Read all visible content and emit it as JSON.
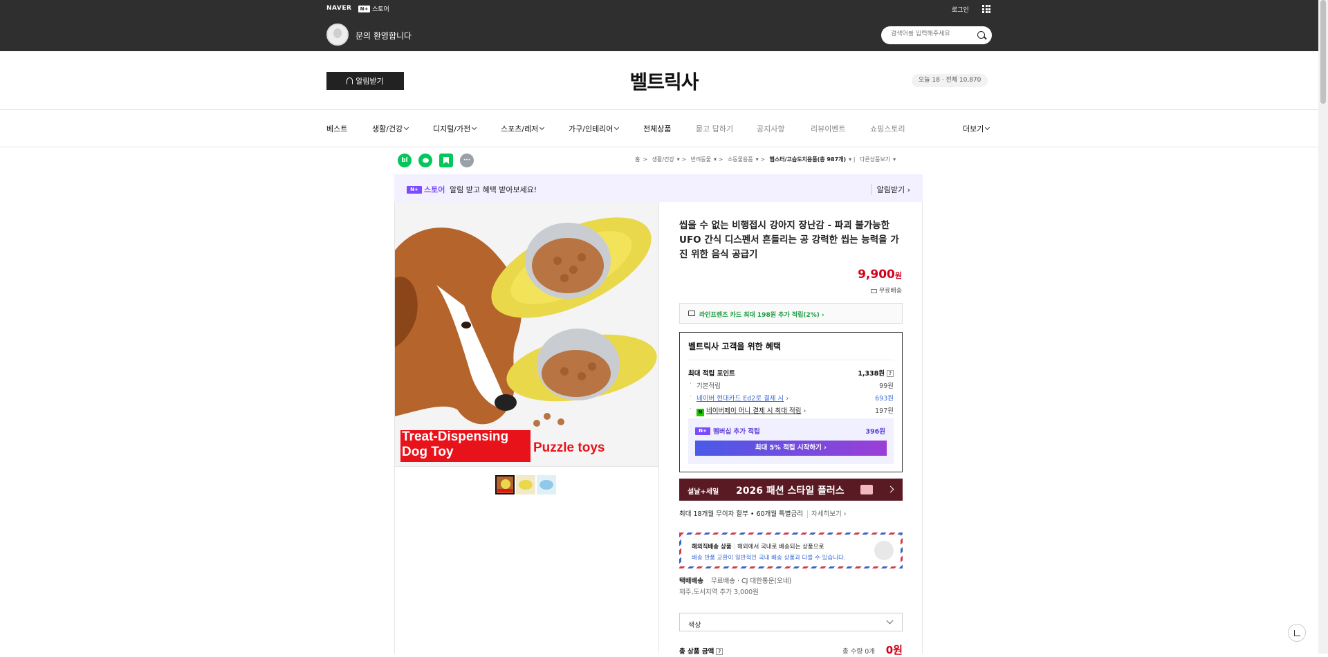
{
  "topbar": {
    "brand": "NAVER",
    "store_badge": "N+",
    "store_label": "스토어",
    "login": "로그인",
    "greeting": "문의 환영합니다",
    "search_placeholder": "검색어를 입력해주세요"
  },
  "header": {
    "alarm_button": "알림받기",
    "store_name": "벨트릭사",
    "visits": "오늘 18 · 전체 10,870"
  },
  "nav": {
    "items": [
      "베스트",
      "생활/건강",
      "디지털/가전",
      "스포츠/레저",
      "가구/인테리어",
      "전체상품",
      "묻고 답하기",
      "공지사항",
      "리뷰이벤트",
      "쇼핑스토리"
    ],
    "more": "더보기"
  },
  "share_buttons": [
    {
      "label": "bl",
      "color": "#03c75a"
    },
    {
      "label": "",
      "color": "#03c75a"
    },
    {
      "label": "",
      "color": "#03c75a"
    },
    {
      "label": "···",
      "color": "#9aa0a6"
    }
  ],
  "breadcrumb": {
    "items": [
      "홈",
      "생활/건강",
      "반려동물",
      "소동물용품",
      "햄스터/고슴도치용품(총 987개)",
      "다른상품보기"
    ]
  },
  "notice": {
    "badge": "N+",
    "brand": "스토어",
    "message": "알림 받고 혜택 받아보세요!",
    "action": "알림받기"
  },
  "product": {
    "title": "씹을 수 없는 비행접시 강아지 장난감 - 파괴 불가능한 UFO 간식 디스펜서 흔들리는 공 강력한 씹는 능력을 가진 위한 음식 공급기",
    "price": "9,900",
    "price_unit": "원",
    "shipping": "무료배송",
    "image_caption_left_1": "Treat-Dispensing",
    "image_caption_left_2": "Dog Toy",
    "image_caption_right": "Puzzle toys"
  },
  "card_promo": "라인프렌즈 카드 최대 198원 추가 적립(2%)",
  "benefit": {
    "heading": "벨트릭사 고객을 위한 혜택",
    "max_point_label": "최대 적립 포인트",
    "max_point_value": "1,338원",
    "rows": [
      {
        "label": "기본적립",
        "value": "99원"
      },
      {
        "label": "네이버 현대카드 Ed2로 결제 시",
        "value": "693원"
      },
      {
        "label": "네이버페이 머니 결제 시 최대 적립",
        "value": "197원"
      }
    ],
    "member_label": "멤버십 추가 적립",
    "member_value": "396원",
    "member_cta": "최대 5% 적립 시작하기"
  },
  "banner": {
    "tag": "설날+세일",
    "text": "2026 패션 스타일 플러스"
  },
  "installment": {
    "text": "최대 18개월 무이자 할부 • 60개월 특별금리",
    "more": "자세히보기"
  },
  "overseas": {
    "title": "해외직배송 상품",
    "desc": "해외에서 국내로 배송되는 상품으로",
    "note": "배송 반품 교환이 일반적인 국내 배송 상품과 다를 수 있습니다."
  },
  "delivery": {
    "type": "택배배송",
    "info": "무료배송 · CJ 대한통운(오네)",
    "extra": "제주,도서지역 추가 3,000원"
  },
  "option": {
    "label": "색상"
  },
  "total": {
    "label": "총 상품 금액",
    "quantity": "총 수량 0개",
    "value": "0원"
  },
  "colors": {
    "topbar": "#2f2f2f",
    "price": "#d0021b",
    "naver_green": "#03c75a",
    "plus_purple": "#7b4cff"
  }
}
